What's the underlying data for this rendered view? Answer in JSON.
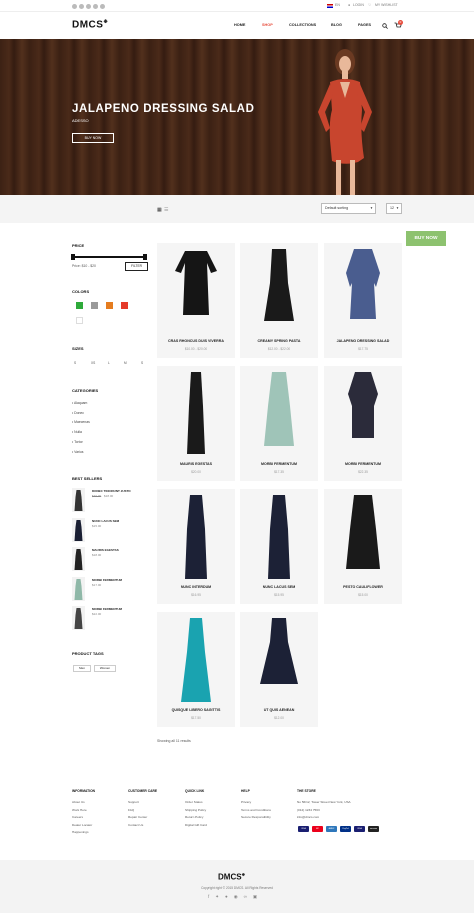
{
  "topbar": {
    "lang": "EN",
    "login": "LOGIN",
    "wishlist": "MY WISHLIST"
  },
  "header": {
    "logo": "DMCS",
    "nav": [
      "HOME",
      "SHOP",
      "COLLECTIONS",
      "BLOG",
      "PAGES"
    ],
    "cart_count": "0",
    "active_color": "#e74c3c"
  },
  "hero": {
    "title": "JALAPENO DRESSING SALAD",
    "subtitle": "ADESSO",
    "button": "BUY NOW"
  },
  "toolbar": {
    "sort": "Default sorting",
    "per_page": "12"
  },
  "buy_now": "BUY NOW",
  "sidebar": {
    "price_heading": "PRICE",
    "price_range": "Price: $10 - $20",
    "filter_button": "FILTER",
    "colors_heading": "COLORS",
    "colors": [
      "#2eaa3a",
      "#9a9a9a",
      "#e57c1f",
      "#e53a2a",
      "#ffffff"
    ],
    "sizes_heading": "SIZES",
    "sizes": [
      "S",
      "XS",
      "L",
      "M",
      "S"
    ],
    "categories_heading": "CATEGORIES",
    "categories": [
      "Alaquam",
      "Donec",
      "Maecenas",
      "Nulla",
      "Tortor",
      "Varius"
    ],
    "bestsellers_heading": "BEST SELLERS",
    "bestsellers": [
      {
        "name": "DONEC TINCIDUNT JUSTO",
        "old_price": "$40.00",
        "price": "$18.00"
      },
      {
        "name": "NUNC LACUS SEM",
        "old_price": "",
        "price": "$15.00"
      },
      {
        "name": "MAURIS EGESTAS",
        "old_price": "",
        "price": "$18.00"
      },
      {
        "name": "MORBI FERMENTUM",
        "old_price": "",
        "price": "$17.00"
      },
      {
        "name": "MORBI FERMENTUM",
        "old_price": "",
        "price": "$22.00"
      }
    ],
    "tags_heading": "PRODUCT TAGS",
    "tags": [
      "Men",
      "Women"
    ]
  },
  "products": [
    {
      "name": "CRAS RHONCUS DUIS VIVERRA",
      "price": "$10.00 - $20.00"
    },
    {
      "name": "CREAMY SPRING PASTA",
      "price": "$12.00 - $22.00"
    },
    {
      "name": "JALAPENO DRESSING SALAD",
      "price": "$17.75"
    },
    {
      "name": "MAURIS EGESTAS",
      "price": "$20.00"
    },
    {
      "name": "MORBI FERMENTUM",
      "price": "$17.35"
    },
    {
      "name": "MORBI FERMENTUM",
      "price": "$22.35"
    },
    {
      "name": "NUNC INTERDUM",
      "price": "$16.95"
    },
    {
      "name": "NUNC LACUS SEM",
      "price": "$15.95"
    },
    {
      "name": "PESTO CAULIFLOWER",
      "price": "$15.00"
    },
    {
      "name": "QUISQUE LIBERO SAGITTIS",
      "price": "$17.50"
    },
    {
      "name": "UT QUIS AENEAN",
      "price": "$12.00"
    }
  ],
  "results_text": "Showing all 11 results",
  "footer": {
    "columns": [
      {
        "heading": "INFORMATION",
        "links": [
          "About Us",
          "Work Here",
          "Careers",
          "Dealer Locator",
          "Happenings"
        ]
      },
      {
        "heading": "CUSTOMER CARE",
        "links": [
          "Support",
          "FAQ",
          "Repair Center",
          "Contact Us"
        ]
      },
      {
        "heading": "QUICK LINK",
        "links": [
          "Order Status",
          "Shipping Policy",
          "Return Policy",
          "Digital Gift Card"
        ]
      },
      {
        "heading": "HELP",
        "links": [
          "Privacy",
          "Terms and Conditions",
          "Secure Responsibility"
        ]
      },
      {
        "heading": "THE STORE",
        "links": [
          "No 56/12, Tower Street New York, USA",
          "(012) 1234 7563",
          "info@dmcs.com"
        ]
      }
    ],
    "payments": [
      "VISA",
      "MC",
      "AMEX",
      "PayPal",
      "VISA",
      "amazon"
    ],
    "logo": "DMCS",
    "copyright": "Copyright right © 2015 DMCS. All Rights Reserved"
  }
}
